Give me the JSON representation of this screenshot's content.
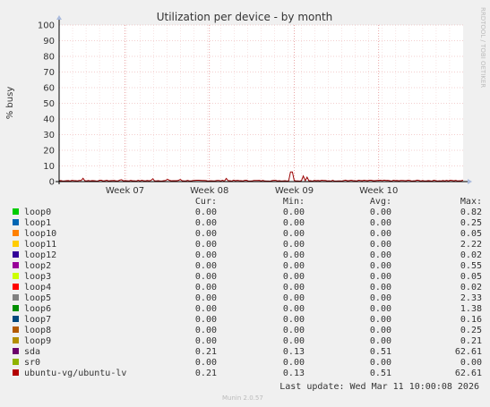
{
  "chart_data": {
    "type": "line",
    "title": "Utilization per device - by month",
    "ylabel": "% busy",
    "ylim": [
      0,
      100
    ],
    "yticks": [
      0,
      10,
      20,
      30,
      40,
      50,
      60,
      70,
      80,
      90,
      100
    ],
    "xticks": [
      "Week 07",
      "Week 08",
      "Week 09",
      "Week 10"
    ],
    "grid": true,
    "watermark": "RRDTOOL / TOBI OETIKER",
    "series_shown": "ubuntu-vg/ubuntu-lv",
    "series_color": "#990000",
    "spikes": [
      {
        "x_frac": 0.06,
        "y": 2.1
      },
      {
        "x_frac": 0.155,
        "y": 1.2
      },
      {
        "x_frac": 0.23,
        "y": 1.8
      },
      {
        "x_frac": 0.27,
        "y": 1.5
      },
      {
        "x_frac": 0.3,
        "y": 1.4
      },
      {
        "x_frac": 0.415,
        "y": 2.0
      },
      {
        "x_frac": 0.575,
        "y": 6.2
      },
      {
        "x_frac": 0.605,
        "y": 3.6
      },
      {
        "x_frac": 0.615,
        "y": 2.8
      },
      {
        "x_frac": 0.71,
        "y": 0.9
      }
    ]
  },
  "legend": {
    "headers": {
      "cur": "Cur:",
      "min": "Min:",
      "avg": "Avg:",
      "max": "Max:"
    },
    "rows": [
      {
        "name": "loop0",
        "color": "#00cc00",
        "cur": "0.00",
        "min": "0.00",
        "avg": "0.00",
        "max": "0.82"
      },
      {
        "name": "loop1",
        "color": "#0066b3",
        "cur": "0.00",
        "min": "0.00",
        "avg": "0.00",
        "max": "0.25"
      },
      {
        "name": "loop10",
        "color": "#ff8000",
        "cur": "0.00",
        "min": "0.00",
        "avg": "0.00",
        "max": "0.05"
      },
      {
        "name": "loop11",
        "color": "#ffcc00",
        "cur": "0.00",
        "min": "0.00",
        "avg": "0.00",
        "max": "2.22"
      },
      {
        "name": "loop12",
        "color": "#330099",
        "cur": "0.00",
        "min": "0.00",
        "avg": "0.00",
        "max": "0.02"
      },
      {
        "name": "loop2",
        "color": "#990099",
        "cur": "0.00",
        "min": "0.00",
        "avg": "0.00",
        "max": "0.55"
      },
      {
        "name": "loop3",
        "color": "#ccff00",
        "cur": "0.00",
        "min": "0.00",
        "avg": "0.00",
        "max": "0.05"
      },
      {
        "name": "loop4",
        "color": "#ff0000",
        "cur": "0.00",
        "min": "0.00",
        "avg": "0.00",
        "max": "0.02"
      },
      {
        "name": "loop5",
        "color": "#808080",
        "cur": "0.00",
        "min": "0.00",
        "avg": "0.00",
        "max": "2.33"
      },
      {
        "name": "loop6",
        "color": "#008f00",
        "cur": "0.00",
        "min": "0.00",
        "avg": "0.00",
        "max": "1.38"
      },
      {
        "name": "loop7",
        "color": "#00487d",
        "cur": "0.00",
        "min": "0.00",
        "avg": "0.00",
        "max": "0.16"
      },
      {
        "name": "loop8",
        "color": "#b35a00",
        "cur": "0.00",
        "min": "0.00",
        "avg": "0.00",
        "max": "0.25"
      },
      {
        "name": "loop9",
        "color": "#b38f00",
        "cur": "0.00",
        "min": "0.00",
        "avg": "0.00",
        "max": "0.21"
      },
      {
        "name": "sda",
        "color": "#6b006b",
        "cur": "0.21",
        "min": "0.13",
        "avg": "0.51",
        "max": "62.61"
      },
      {
        "name": "sr0",
        "color": "#8fb300",
        "cur": "0.00",
        "min": "0.00",
        "avg": "0.00",
        "max": "0.00"
      },
      {
        "name": "ubuntu-vg/ubuntu-lv",
        "color": "#b30000",
        "cur": "0.21",
        "min": "0.13",
        "avg": "0.51",
        "max": "62.61"
      }
    ]
  },
  "footer": {
    "last_update": "Last update: Wed Mar 11 10:00:08 2026",
    "munin_version": "Munin 2.0.57"
  }
}
